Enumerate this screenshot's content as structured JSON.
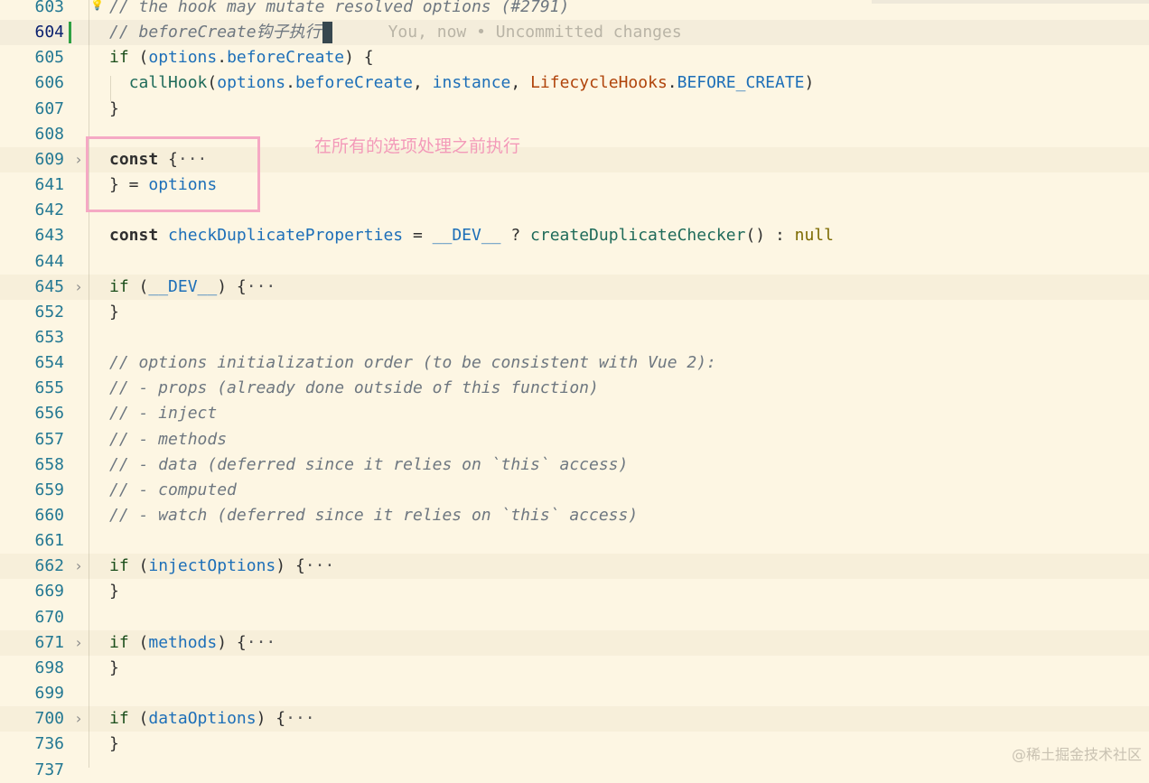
{
  "editor": {
    "lines": [
      {
        "num": "603",
        "tokens": [
          {
            "t": "// the hook may mutate resolved options (#2791)",
            "c": "cm"
          }
        ]
      },
      {
        "num": "604",
        "cursor": true,
        "tokens": [
          {
            "t": "// beforeCreate钩子执行",
            "c": "cm"
          }
        ]
      },
      {
        "num": "605",
        "tokens": [
          {
            "t": "if",
            "c": "kw"
          },
          {
            "t": " (",
            "c": "pn"
          },
          {
            "t": "options",
            "c": "id"
          },
          {
            "t": ".",
            "c": "pn"
          },
          {
            "t": "beforeCreate",
            "c": "id"
          },
          {
            "t": ") {",
            "c": "pn"
          }
        ]
      },
      {
        "num": "606",
        "tokens": [
          {
            "t": "  ",
            "c": "pn"
          },
          {
            "t": "callHook",
            "c": "fn"
          },
          {
            "t": "(",
            "c": "pn"
          },
          {
            "t": "options",
            "c": "id"
          },
          {
            "t": ".",
            "c": "pn"
          },
          {
            "t": "beforeCreate",
            "c": "id"
          },
          {
            "t": ", ",
            "c": "pn"
          },
          {
            "t": "instance",
            "c": "id"
          },
          {
            "t": ", ",
            "c": "pn"
          },
          {
            "t": "LifecycleHooks",
            "c": "cls"
          },
          {
            "t": ".",
            "c": "pn"
          },
          {
            "t": "BEFORE_CREATE",
            "c": "id"
          },
          {
            "t": ")",
            "c": "pn"
          }
        ]
      },
      {
        "num": "607",
        "tokens": [
          {
            "t": "}",
            "c": "pn"
          }
        ]
      },
      {
        "num": "608",
        "tokens": []
      },
      {
        "num": "609",
        "fold": true,
        "tokens": [
          {
            "t": "const",
            "c": "kw-const"
          },
          {
            "t": " {",
            "c": "pn"
          },
          {
            "t": "···",
            "c": "ell"
          }
        ]
      },
      {
        "num": "641",
        "tokens": [
          {
            "t": "} = ",
            "c": "pn"
          },
          {
            "t": "options",
            "c": "id"
          }
        ]
      },
      {
        "num": "642",
        "tokens": []
      },
      {
        "num": "643",
        "tokens": [
          {
            "t": "const",
            "c": "kw-const"
          },
          {
            "t": " ",
            "c": "pn"
          },
          {
            "t": "checkDuplicateProperties",
            "c": "id"
          },
          {
            "t": " = ",
            "c": "pn"
          },
          {
            "t": "__DEV__",
            "c": "id"
          },
          {
            "t": " ? ",
            "c": "pn"
          },
          {
            "t": "createDuplicateChecker",
            "c": "fn"
          },
          {
            "t": "() : ",
            "c": "pn"
          },
          {
            "t": "null",
            "c": "lit"
          }
        ]
      },
      {
        "num": "644",
        "tokens": []
      },
      {
        "num": "645",
        "fold": true,
        "tokens": [
          {
            "t": "if",
            "c": "kw"
          },
          {
            "t": " (",
            "c": "pn"
          },
          {
            "t": "__DEV__",
            "c": "id"
          },
          {
            "t": ") {",
            "c": "pn"
          },
          {
            "t": "···",
            "c": "ell"
          }
        ]
      },
      {
        "num": "652",
        "tokens": [
          {
            "t": "}",
            "c": "pn"
          }
        ]
      },
      {
        "num": "653",
        "tokens": []
      },
      {
        "num": "654",
        "tokens": [
          {
            "t": "// options initialization order (to be consistent with Vue 2):",
            "c": "cm"
          }
        ]
      },
      {
        "num": "655",
        "tokens": [
          {
            "t": "// - props (already done outside of this function)",
            "c": "cm"
          }
        ]
      },
      {
        "num": "656",
        "tokens": [
          {
            "t": "// - inject",
            "c": "cm"
          }
        ]
      },
      {
        "num": "657",
        "tokens": [
          {
            "t": "// - methods",
            "c": "cm"
          }
        ]
      },
      {
        "num": "658",
        "tokens": [
          {
            "t": "// - data (deferred since it relies on `this` access)",
            "c": "cm"
          }
        ]
      },
      {
        "num": "659",
        "tokens": [
          {
            "t": "// - computed",
            "c": "cm"
          }
        ]
      },
      {
        "num": "660",
        "tokens": [
          {
            "t": "// - watch (deferred since it relies on `this` access)",
            "c": "cm"
          }
        ]
      },
      {
        "num": "661",
        "tokens": []
      },
      {
        "num": "662",
        "fold": true,
        "tokens": [
          {
            "t": "if",
            "c": "kw"
          },
          {
            "t": " (",
            "c": "pn"
          },
          {
            "t": "injectOptions",
            "c": "id"
          },
          {
            "t": ") {",
            "c": "pn"
          },
          {
            "t": "···",
            "c": "ell"
          }
        ]
      },
      {
        "num": "669",
        "tokens": [
          {
            "t": "}",
            "c": "pn"
          }
        ]
      },
      {
        "num": "670",
        "tokens": []
      },
      {
        "num": "671",
        "fold": true,
        "tokens": [
          {
            "t": "if",
            "c": "kw"
          },
          {
            "t": " (",
            "c": "pn"
          },
          {
            "t": "methods",
            "c": "id"
          },
          {
            "t": ") {",
            "c": "pn"
          },
          {
            "t": "···",
            "c": "ell"
          }
        ]
      },
      {
        "num": "698",
        "tokens": [
          {
            "t": "}",
            "c": "pn"
          }
        ]
      },
      {
        "num": "699",
        "tokens": []
      },
      {
        "num": "700",
        "fold": true,
        "tokens": [
          {
            "t": "if",
            "c": "kw"
          },
          {
            "t": " (",
            "c": "pn"
          },
          {
            "t": "dataOptions",
            "c": "id"
          },
          {
            "t": ") {",
            "c": "pn"
          },
          {
            "t": "···",
            "c": "ell"
          }
        ]
      },
      {
        "num": "736",
        "tokens": [
          {
            "t": "}",
            "c": "pn"
          }
        ]
      },
      {
        "num": "737",
        "tokens": []
      }
    ],
    "blame_text": "You, now • Uncommitted changes",
    "fold_icon": "chevron-right-icon"
  },
  "annotation": {
    "text": "在所有的选项处理之前执行",
    "color": "#f39ab9"
  },
  "watermark": "@稀土掘金技术社区",
  "colors": {
    "background": "#fdf6e3",
    "line_number": "#237893",
    "comment": "#6e7780",
    "identifier": "#1d6fb8",
    "keyword": "#1a4d1a",
    "class": "#b0440b",
    "literal": "#7c6a00",
    "annotation_box": "#f5a9c4",
    "git_modified": "#2ea043"
  }
}
